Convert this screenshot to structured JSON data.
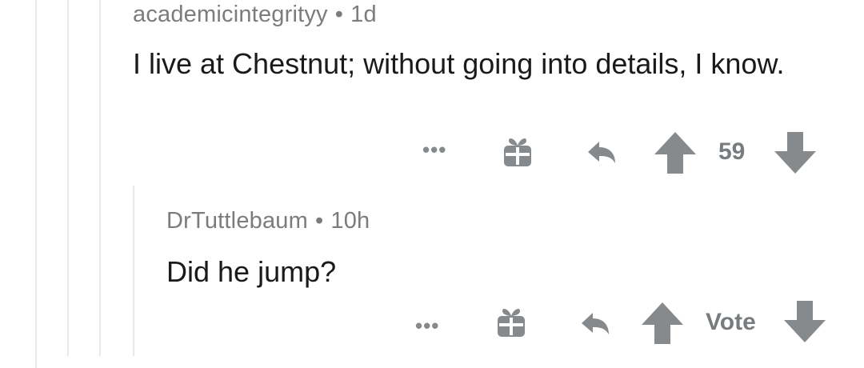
{
  "thread": {
    "parent_comment": {
      "username": "academicintegrityy",
      "separator": "•",
      "timestamp": "1d",
      "body": "I live at Chestnut; without going into details, I know.",
      "actions": {
        "more_label": "•••",
        "vote_count": "59"
      }
    },
    "reply_comment": {
      "username": "DrTuttlebaum",
      "separator": "•",
      "timestamp": "10h",
      "body": "Did he jump?",
      "actions": {
        "more_label": "•••",
        "vote_label": "Vote"
      }
    }
  },
  "icons": {
    "more": "more-dots-icon",
    "award": "gift-icon",
    "reply": "reply-arrow-icon",
    "upvote": "upvote-arrow-icon",
    "downvote": "downvote-arrow-icon"
  },
  "colors": {
    "icon_gray": "#878a8c",
    "thread_line": "#e9e9e9",
    "meta_text": "#7c7c7c",
    "body_text": "#1a1a1b"
  }
}
